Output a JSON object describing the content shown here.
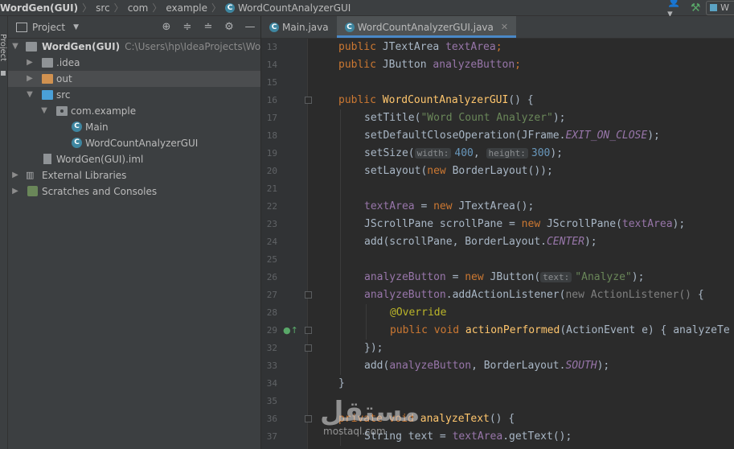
{
  "breadcrumb": {
    "items": [
      "WordGen(GUI)",
      "src",
      "com",
      "example",
      "WordCountAnalyzerGUI"
    ]
  },
  "toolbar": {
    "run_config_label": "W"
  },
  "tool_strip": {
    "project_label": "Project"
  },
  "project_panel": {
    "title": "Project",
    "tree": [
      {
        "label": "WordGen(GUI)",
        "path": "C:\\Users\\hp\\IdeaProjects\\WordGen",
        "icon": "module-folder-icon"
      },
      {
        "label": ".idea",
        "icon": "folder-icon"
      },
      {
        "label": "out",
        "icon": "excluded-folder-icon",
        "selected": true
      },
      {
        "label": "src",
        "icon": "source-folder-icon"
      },
      {
        "label": "com.example",
        "icon": "package-icon"
      },
      {
        "label": "Main",
        "icon": "java-class-icon"
      },
      {
        "label": "WordCountAnalyzerGUI",
        "icon": "java-class-icon"
      },
      {
        "label": "WordGen(GUI).iml",
        "icon": "iml-file-icon"
      },
      {
        "label": "External Libraries",
        "icon": "libraries-icon"
      },
      {
        "label": "Scratches and Consoles",
        "icon": "scratches-icon"
      }
    ]
  },
  "editor": {
    "tabs": [
      {
        "label": "Main.java",
        "active": false
      },
      {
        "label": "WordCountAnalyzerGUI.java",
        "active": true
      }
    ],
    "line_numbers": [
      "13",
      "14",
      "15",
      "16",
      "17",
      "18",
      "19",
      "20",
      "21",
      "22",
      "23",
      "24",
      "25",
      "26",
      "27",
      "28",
      "29",
      "32",
      "33",
      "34",
      "35",
      "36",
      "37"
    ],
    "code": {
      "l13_kw": "public",
      "l13_type": "JTextArea",
      "l13_field": "textArea",
      "l13_end": ";",
      "l14_kw": "public",
      "l14_type": "JButton",
      "l14_field": "analyzeButton",
      "l14_end": ";",
      "l16_kw": "public",
      "l16_name": "WordCountAnalyzerGUI",
      "l16_end": "() {",
      "l17_a": "setTitle(",
      "l17_str": "\"Word Count Analyzer\"",
      "l17_b": ");",
      "l18_a": "setDefaultCloseOperation(JFrame.",
      "l18_const": "EXIT_ON_CLOSE",
      "l18_b": ");",
      "l19_a": "setSize(",
      "l19_hint1": "width:",
      "l19_num1": "400",
      "l19_sep": ", ",
      "l19_hint2": "height:",
      "l19_num2": "300",
      "l19_b": ");",
      "l20_a": "setLayout(",
      "l20_kw": "new",
      "l20_b": " BorderLayout());",
      "l22_field": "textArea",
      "l22_a": " = ",
      "l22_kw": "new",
      "l22_b": " JTextArea();",
      "l23_a": "JScrollPane scrollPane = ",
      "l23_kw": "new",
      "l23_b": " JScrollPane(",
      "l23_field": "textArea",
      "l23_c": ");",
      "l24_a": "add(scrollPane, BorderLayout.",
      "l24_const": "CENTER",
      "l24_b": ");",
      "l26_field": "analyzeButton",
      "l26_a": " = ",
      "l26_kw": "new",
      "l26_b": " JButton(",
      "l26_hint": "text:",
      "l26_str": "\"Analyze\"",
      "l26_c": ");",
      "l27_field": "analyzeButton",
      "l27_a": ".addActionListener(",
      "l27_dim": "new ActionListener()",
      "l27_b": " {",
      "l28_ann": "@Override",
      "l29_kw": "public void",
      "l29_fn": "actionPerformed",
      "l29_a": "(ActionEvent e)",
      "l29_b": " { analyzeTe",
      "l32": "});",
      "l33_a": "add(",
      "l33_field": "analyzeButton",
      "l33_b": ", BorderLayout.",
      "l33_const": "SOUTH",
      "l33_c": ");",
      "l34": "}",
      "l36_kw": "private void",
      "l36_fn": "analyzeText",
      "l36_end": "() {",
      "l37_a": "String text = ",
      "l37_field": "textArea",
      "l37_b": ".getText();"
    }
  },
  "watermark": {
    "main": "مستقل",
    "sub": "mostaql.com"
  }
}
